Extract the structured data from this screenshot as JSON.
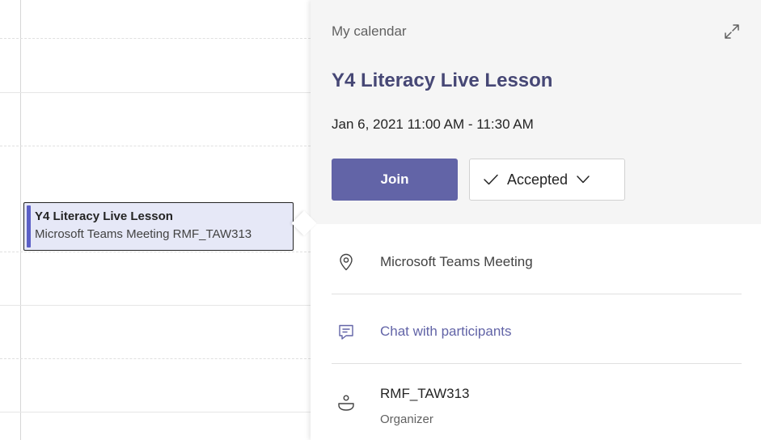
{
  "calendar_event": {
    "title": "Y4 Literacy Live Lesson",
    "subtitle": "Microsoft Teams Meeting  RMF_TAW313"
  },
  "card": {
    "calendar_name": "My calendar",
    "title": "Y4 Literacy Live Lesson",
    "time": "Jan 6, 2021 11:00 AM - 11:30 AM",
    "join_label": "Join",
    "rsvp_label": "Accepted",
    "location": "Microsoft Teams Meeting",
    "chat_label": "Chat with participants",
    "organizer_name": "RMF_TAW313",
    "organizer_role": "Organizer"
  },
  "colors": {
    "accent": "#6264a7",
    "title": "#464775",
    "event_fill": "#e6e8f7",
    "event_accent": "#5b5fc7"
  },
  "icons": [
    "expand-icon",
    "check-icon",
    "chevron-down-icon",
    "location-icon",
    "chat-icon",
    "organizer-icon"
  ]
}
